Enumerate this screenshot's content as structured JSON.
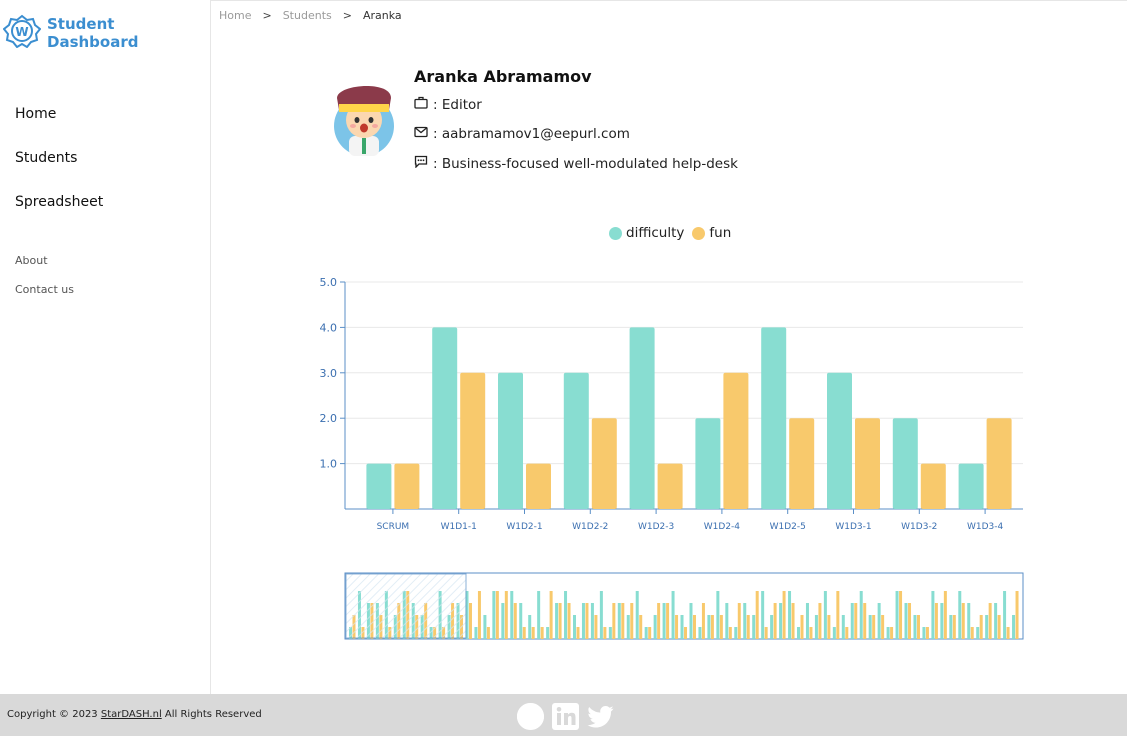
{
  "brand": {
    "title": "Student Dashboard",
    "accent": "#3b8ed0"
  },
  "sidebar": {
    "main": [
      {
        "label": "Home"
      },
      {
        "label": "Students"
      },
      {
        "label": "Spreadsheet"
      }
    ],
    "secondary": [
      {
        "label": "About"
      },
      {
        "label": "Contact us"
      }
    ]
  },
  "breadcrumb": {
    "items": [
      "Home",
      "Students",
      "Aranka"
    ],
    "separator": ">"
  },
  "profile": {
    "name": "Aranka Abramamov",
    "role": ": Editor",
    "email": ": aabramamov1@eepurl.com",
    "motto": ": Business-focused well-modulated help-desk",
    "icons": [
      "briefcase-icon",
      "mail-icon",
      "message-icon"
    ]
  },
  "chart_data": {
    "type": "bar",
    "categories": [
      "SCRUM",
      "W1D1-1",
      "W1D2-1",
      "W1D2-2",
      "W1D2-3",
      "W1D2-4",
      "W1D2-5",
      "W1D3-1",
      "W1D3-2",
      "W1D3-4"
    ],
    "series": [
      {
        "name": "difficulty",
        "color": "#88ddd1",
        "values": [
          1,
          4,
          3,
          3,
          4,
          2,
          4,
          3,
          2,
          1
        ]
      },
      {
        "name": "fun",
        "color": "#f8c96c",
        "values": [
          1,
          3,
          1,
          2,
          1,
          3,
          2,
          2,
          1,
          2
        ]
      }
    ],
    "ylim": [
      0,
      5
    ],
    "yticks": [
      "1.0",
      "2.0",
      "3.0",
      "4.0",
      "5.0"
    ],
    "grid": true,
    "legend": "top-center",
    "brush": {
      "difficulty": [
        1,
        4,
        3,
        3,
        4,
        2,
        4,
        3,
        2,
        1,
        4,
        2,
        3,
        4,
        1,
        2,
        4,
        3,
        4,
        3,
        2,
        4,
        1,
        3,
        4,
        2,
        3,
        3,
        4,
        1,
        3,
        2,
        4,
        1,
        2,
        3,
        4,
        2,
        3,
        1,
        2,
        4,
        3,
        1,
        3,
        2,
        4,
        2,
        3,
        4,
        1,
        3,
        2,
        4,
        1,
        2,
        3,
        4,
        2,
        3,
        1,
        4,
        3,
        2,
        1,
        4,
        3,
        2,
        4,
        3,
        1,
        2,
        3,
        4,
        2
      ],
      "fun": [
        2,
        1,
        3,
        2,
        1,
        3,
        4,
        2,
        3,
        1,
        1,
        3,
        2,
        3,
        4,
        1,
        4,
        4,
        3,
        1,
        1,
        1,
        4,
        3,
        3,
        1,
        3,
        2,
        1,
        3,
        3,
        3,
        2,
        1,
        3,
        3,
        2,
        1,
        2,
        3,
        2,
        2,
        1,
        3,
        2,
        4,
        1,
        3,
        4,
        3,
        2,
        1,
        3,
        2,
        4,
        1,
        3,
        3,
        2,
        2,
        1,
        4,
        3,
        2,
        1,
        3,
        4,
        2,
        3,
        1,
        2,
        3,
        2,
        1,
        4
      ]
    }
  },
  "footer": {
    "copyright_prefix": "Copyright © 2023 ",
    "company_link": "StarDASH.nl",
    "copyright_suffix": " All Rights Reserved",
    "social": [
      "github-icon",
      "linkedin-icon",
      "twitter-icon"
    ]
  }
}
